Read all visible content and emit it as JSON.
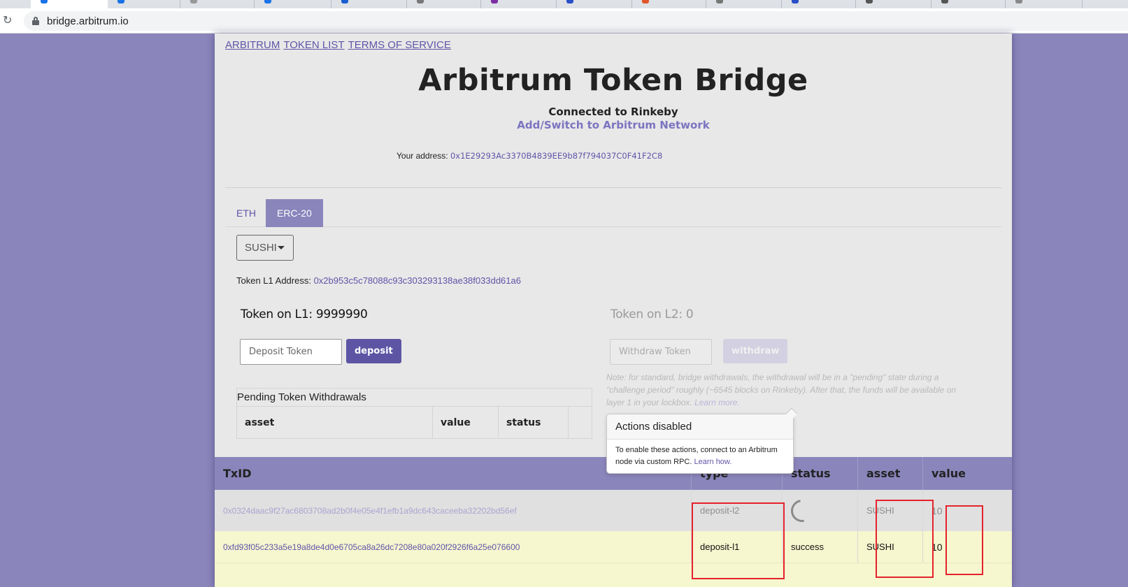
{
  "browser": {
    "url": "bridge.arbitrum.io"
  },
  "nav": {
    "links": [
      "ARBITRUM",
      "TOKEN LIST",
      "TERMS OF SERVICE"
    ]
  },
  "header": {
    "title": "Arbitrum Token Bridge",
    "connected": "Connected to Rinkeby",
    "switch_network": "Add/Switch to Arbitrum Network",
    "address_label": "Your address: ",
    "address": "0x1E29293Ac3370B4839EE9b87f794037C0F41F2C8"
  },
  "tabs": {
    "items": [
      "ETH",
      "ERC-20"
    ],
    "active": "ERC-20"
  },
  "token": {
    "selected": "SUSHI",
    "l1_address_label": "Token L1 Address: ",
    "l1_address": "0x2b953c5c78088c93c303293138ae38f033dd61a6"
  },
  "l1": {
    "balance": "Token on L1: 9999990",
    "input_placeholder": "Deposit Token",
    "button": "deposit"
  },
  "l2": {
    "balance": "Token on L2: 0",
    "input_placeholder": "Withdraw Token",
    "button": "withdraw",
    "note": "Note: for standard, bridge withdrawals, the withdrawal will be in a \"pending\" state during a \"challenge period\" roughly (~6545 blocks on Rinkeby). After that, the funds will be available on layer 1 in your lockbox.",
    "learn_more": "Learn more."
  },
  "pending_withdrawals": {
    "title": "Pending Token Withdrawals",
    "columns": [
      "asset",
      "value",
      "status"
    ]
  },
  "tooltip": {
    "title": "Actions disabled",
    "body": "To enable these actions, connect to an Arbitrum node via custom RPC.",
    "learn_how": "Learn how."
  },
  "transactions": {
    "columns": [
      "TxID",
      "type",
      "status",
      "asset",
      "value"
    ],
    "rows": [
      {
        "txid": "0x0324daac9f27ac6803708ad2b0f4e05e4f1efb1a9dc643caceeba32202bd56ef",
        "type": "deposit-l2",
        "status": "",
        "asset": "SUSHI",
        "value": "10"
      },
      {
        "txid": "0xfd93f05c233a5e19a8de4d0e6705ca8a26dc7208e80a020f2926f6a25e076600",
        "type": "deposit-l1",
        "status": "success",
        "asset": "SUSHI",
        "value": "10"
      }
    ]
  },
  "colors": {
    "background": "#8a85bb",
    "accent": "#5f55a8",
    "annotation": "#e5222c",
    "success_row": "#f6f6cf"
  }
}
